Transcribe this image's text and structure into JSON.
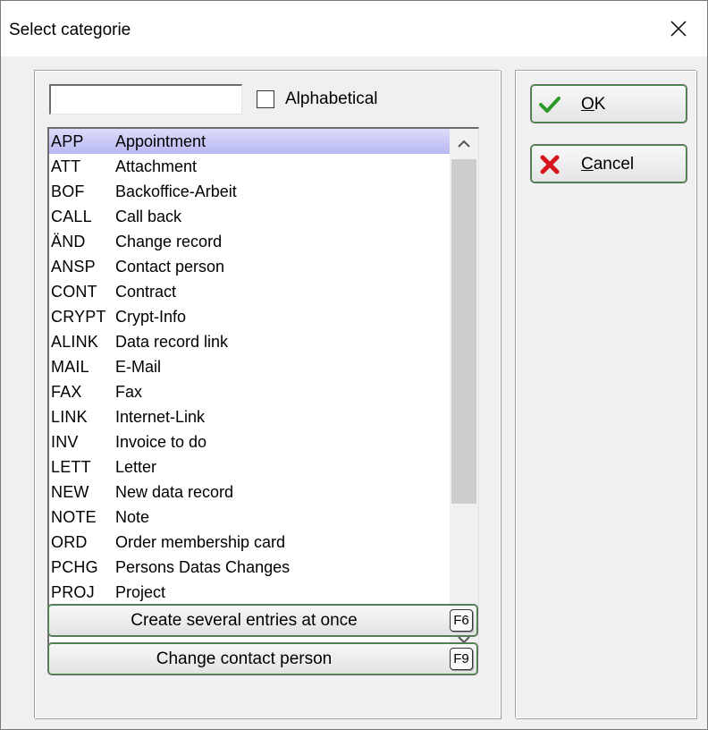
{
  "window": {
    "title": "Select categorie",
    "close_icon": "close-icon"
  },
  "search": {
    "value": "",
    "placeholder": ""
  },
  "alphabetical": {
    "label": "Alphabetical",
    "checked": false
  },
  "list": {
    "selected_index": 0,
    "items": [
      {
        "code": "APP",
        "desc": "Appointment"
      },
      {
        "code": "ATT",
        "desc": "Attachment"
      },
      {
        "code": "BOF",
        "desc": "Backoffice-Arbeit"
      },
      {
        "code": "CALL",
        "desc": "Call back"
      },
      {
        "code": "ÄND",
        "desc": "Change record"
      },
      {
        "code": "ANSP",
        "desc": "Contact person"
      },
      {
        "code": "CONT",
        "desc": "Contract"
      },
      {
        "code": "CRYPT",
        "desc": "Crypt-Info"
      },
      {
        "code": "ALINK",
        "desc": "Data record link"
      },
      {
        "code": "MAIL",
        "desc": "E-Mail"
      },
      {
        "code": "FAX",
        "desc": "Fax"
      },
      {
        "code": "LINK",
        "desc": "Internet-Link"
      },
      {
        "code": "INV",
        "desc": "Invoice to do"
      },
      {
        "code": "LETT",
        "desc": "Letter"
      },
      {
        "code": "NEW",
        "desc": "New data record"
      },
      {
        "code": "NOTE",
        "desc": "Note"
      },
      {
        "code": "ORD",
        "desc": "Order membership card"
      },
      {
        "code": "PCHG",
        "desc": "Persons Datas Changes"
      },
      {
        "code": "PROJ",
        "desc": "Project"
      }
    ]
  },
  "buttons": {
    "several_entries": {
      "label": "Create several entries at once",
      "key": "F6"
    },
    "change_contact": {
      "label": "Change contact person",
      "key": "F9"
    },
    "ok": {
      "label": "OK",
      "icon": "check-icon"
    },
    "cancel": {
      "label": "Cancel",
      "icon": "x-icon"
    }
  },
  "colors": {
    "selection_top": "#dcdcfc",
    "selection_bottom": "#b8b8f2",
    "button_focus_border": "#3c8a3c",
    "ok_check": "#2a9a2a",
    "cancel_x": "#d8141e"
  }
}
